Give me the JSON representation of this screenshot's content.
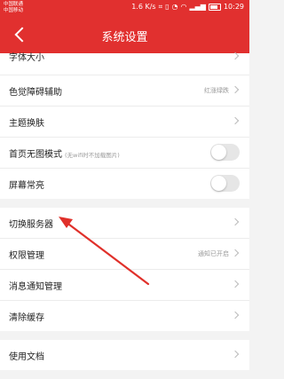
{
  "status": {
    "carrier1": "中国联通",
    "carrier2": "中国移动",
    "speed": "1.6 K/s",
    "time": "10:29"
  },
  "header": {
    "title": "系统设置"
  },
  "groups": [
    {
      "rows": [
        {
          "label": "字体大小"
        },
        {
          "label": "色觉障碍辅助",
          "value": "红涨绿跌"
        },
        {
          "label": "主题换肤"
        },
        {
          "label": "首页无图模式",
          "subtag": "(无wifi时不加载图片)"
        },
        {
          "label": "屏幕常亮"
        }
      ]
    },
    {
      "rows": [
        {
          "label": "切换服务器"
        },
        {
          "label": "权限管理",
          "value": "通知已开启"
        },
        {
          "label": "消息通知管理"
        },
        {
          "label": "清除缓存"
        }
      ]
    },
    {
      "rows": [
        {
          "label": "使用文档"
        }
      ]
    }
  ],
  "colors": {
    "accent": "#e1302f",
    "annotation_arrow": "#e0302a"
  }
}
